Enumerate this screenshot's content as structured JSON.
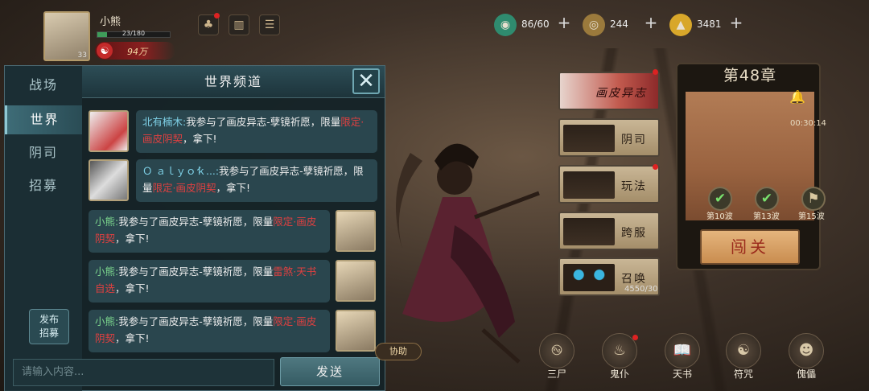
{
  "player": {
    "name": "小熊",
    "level": "33",
    "exp_text": "23/180",
    "exp_fraction": 0.128,
    "power": "94万"
  },
  "resources": [
    {
      "name": "stamina",
      "value": "86/60",
      "icon_color": "#2f8b6f"
    },
    {
      "name": "copper-coin",
      "value": "244",
      "icon_color": "#9b7a3c"
    },
    {
      "name": "gold-ingot",
      "value": "3481",
      "icon_color": "#d8a72a"
    }
  ],
  "chat": {
    "title": "世界频道",
    "tabs": [
      "战场",
      "世界",
      "阴司",
      "招募"
    ],
    "active_tab": "世界",
    "publish": "发布招募",
    "input_placeholder": "请输入内容...",
    "send": "发送",
    "messages": [
      {
        "name": "北有楠木:",
        "name_color": "blue",
        "pre": "我参与了画皮异志-孽镜祈愿，限量",
        "highlight": "限定·画皮阴契",
        "post": "，拿下!"
      },
      {
        "name": "Ｏ ａｌｙｏ́ｋ...:",
        "name_color": "blue",
        "pre": "我参与了画皮异志-孽镜祈愿，限量",
        "highlight": "限定·画皮阴契",
        "post": "，拿下!"
      },
      {
        "name": "小熊:",
        "name_color": "green",
        "pre": "我参与了画皮异志-孽镜祈愿，限量",
        "highlight": "限定·画皮阴契",
        "post": "，拿下!"
      },
      {
        "name": "小熊:",
        "name_color": "green",
        "pre": "我参与了画皮异志-孽镜祈愿，限量",
        "highlight": "雷煞·天书自选",
        "post": "，拿下!"
      },
      {
        "name": "小熊:",
        "name_color": "green",
        "pre": "我参与了画皮异志-孽镜祈愿，限量",
        "highlight": "限定·画皮阴契",
        "post": "，拿下!"
      }
    ]
  },
  "assist": "协助",
  "menu": [
    {
      "label": "画皮异志"
    },
    {
      "label": "阴司"
    },
    {
      "label": "玩法"
    },
    {
      "label": "跨服"
    },
    {
      "label": "召唤"
    }
  ],
  "summon_count": "4550/30",
  "chapter": {
    "title": "第48章",
    "timer": "00:30:14",
    "stages": [
      "第10波",
      "第13波",
      "第15波"
    ],
    "pass_button": "闯关"
  },
  "bottom_nav": [
    "三尸",
    "鬼仆",
    "天书",
    "符咒",
    "傀儡"
  ]
}
